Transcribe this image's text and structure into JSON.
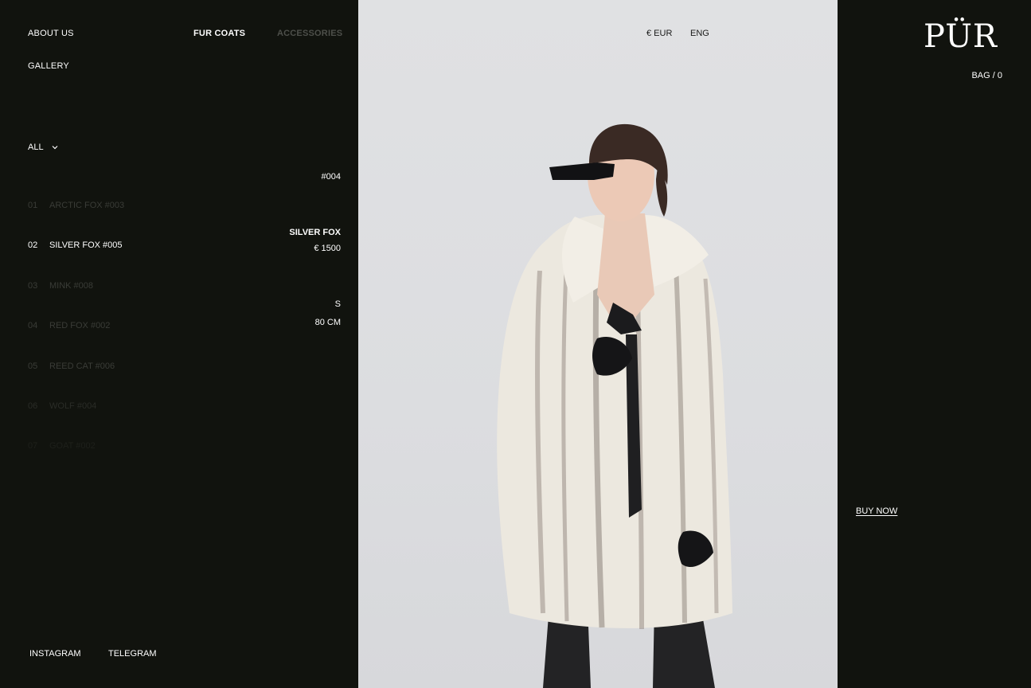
{
  "nav": {
    "about": "ABOUT US",
    "gallery": "GALLERY",
    "fur_coats": "FUR COATS",
    "accessories": "ACCESSORIES"
  },
  "filter": {
    "label": "ALL",
    "icon": "chevron-down-icon"
  },
  "products": [
    {
      "num": "01",
      "name": "ARCTIC FOX #003",
      "state": "dim"
    },
    {
      "num": "02",
      "name": "SILVER FOX #005",
      "state": "active"
    },
    {
      "num": "03",
      "name": "MINK #008",
      "state": "dim"
    },
    {
      "num": "04",
      "name": "RED FOX #002",
      "state": "dim"
    },
    {
      "num": "05",
      "name": "REED CAT #006",
      "state": "dim"
    },
    {
      "num": "06",
      "name": "WOLF #004",
      "state": "dim"
    },
    {
      "num": "07",
      "name": "GOAT #002",
      "state": "dim"
    }
  ],
  "detail": {
    "code": "#004",
    "name": "SILVER FOX",
    "price": "€ 1500",
    "size": "S",
    "length": "80 CM"
  },
  "header": {
    "currency": "€ EUR",
    "language": "ENG",
    "logo": "PÜR",
    "bag": "BAG / 0"
  },
  "actions": {
    "buy_now": "BUY NOW"
  },
  "social": {
    "instagram": "INSTAGRAM",
    "telegram": "TELEGRAM"
  },
  "colors": {
    "background": "#11130e",
    "photo_background": "#dedfe1",
    "text": "#ffffff",
    "muted": "#4d4f4a"
  }
}
